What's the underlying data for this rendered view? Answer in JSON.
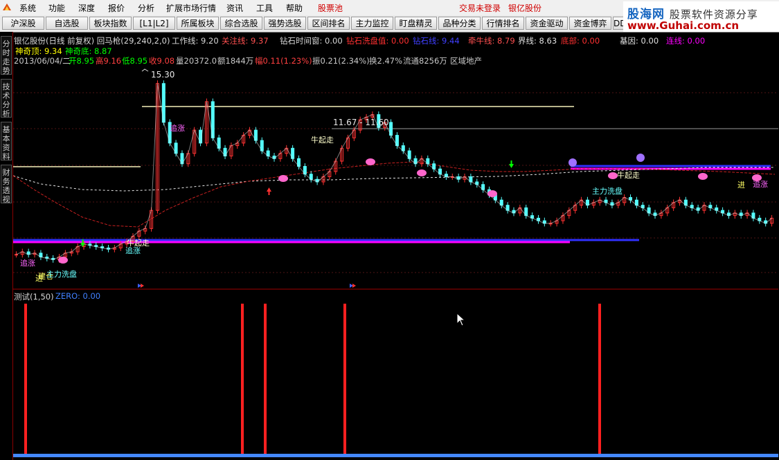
{
  "menu": {
    "items": [
      "系统",
      "功能",
      "深度",
      "报价",
      "分析",
      "扩展市场行情",
      "资讯",
      "工具",
      "帮助"
    ],
    "stock_pool": "股票池",
    "login_status": "交易未登录",
    "stock_name": "银亿股份"
  },
  "toolbar": {
    "buttons": [
      "沪深股",
      "自选股",
      "板块指数",
      "[L1|L2]",
      "所属板块",
      "综合选股",
      "强势选股",
      "区间排名",
      "主力监控",
      "盯盘精灵",
      "品种分类",
      "行情排名",
      "资金驱动",
      "资金博弈",
      "DD"
    ]
  },
  "brand": {
    "name": "股海网",
    "tagline": "股票软件资源分享",
    "url": "www.Guhai.com.cn"
  },
  "side_tabs": [
    "分时走势",
    "技术分析",
    "基本资料",
    "财务透视"
  ],
  "chart_header": {
    "line1": [
      "银亿股份(日线 前复权) 回马枪(29,240,2,0)",
      "工作线: 9.20",
      "关注线: 9.37",
      "钻石时间窗: 0.00",
      "钻石洗盘值: 0.00",
      "钻石线: 9.44",
      "牵牛线: 8.79",
      "界线: 8.63",
      "底部: 0.00",
      "基因: 0.00",
      "连线: 0.00"
    ],
    "line2": [
      "神奇顶: 9.34",
      "神奇底: 8.87"
    ],
    "line3": [
      "2013/06/04/二",
      "开8.95",
      "高9.16",
      "低8.95",
      "收9.08",
      "量20372.0",
      "额1844万",
      "幅0.11(1.23%)",
      "振0.21(2.34%)",
      "换2.47%",
      "流通8256万",
      "区域地产"
    ]
  },
  "annotations": {
    "high_price": "15.30",
    "range_label": "11.67 - 11.60",
    "labels": [
      "追涨",
      "牛起走",
      "建仓",
      "主力洗盘",
      "进",
      "追涨",
      "牛起走",
      "主力洗盘",
      "追涨",
      "牛起走",
      "进",
      "追涨"
    ]
  },
  "indicator": {
    "title": "测试(1,50)",
    "zero_label": "ZERO: 0.00"
  },
  "colors": {
    "up": "#ff3232",
    "down": "#54fcfc",
    "magenta": "#ff00ff",
    "blue": "#3030ff",
    "yellow": "#ffff00"
  },
  "chart_data": {
    "type": "line",
    "series": [
      {
        "values": [
          8.7,
          8.8,
          8.7,
          8.75,
          8.6,
          8.55,
          8.5,
          8.6,
          8.75,
          8.8,
          9.0,
          9.1,
          9.05,
          9.0,
          8.95,
          8.9,
          8.95,
          9.1,
          9.2,
          9.4,
          9.6,
          9.7,
          10.4,
          15.3,
          13.8,
          13.0,
          12.6,
          12.2,
          12.6,
          13.5,
          13.0,
          14.6,
          13.2,
          12.8,
          12.5,
          12.9,
          13.0,
          13.3,
          13.5,
          13.1,
          12.7,
          12.5,
          12.4,
          12.6,
          12.8,
          12.4,
          12.1,
          11.8,
          11.6,
          11.5,
          11.7,
          11.9,
          12.3,
          12.8,
          13.2,
          13.5,
          13.9,
          14.0,
          14.1,
          13.6,
          13.8,
          13.3,
          12.9,
          12.7,
          12.4,
          12.2,
          12.4,
          12.2,
          12.0,
          11.8,
          11.7,
          11.7,
          11.6,
          11.7,
          11.5,
          11.4,
          11.2,
          11.0,
          10.8,
          10.6,
          10.4,
          10.3,
          10.5,
          10.2,
          10.1,
          10.0,
          9.9,
          9.9,
          10.0,
          10.2,
          10.4,
          10.6,
          10.8,
          10.6,
          10.7,
          10.8,
          10.7,
          10.6,
          10.7,
          10.9,
          10.8,
          10.6,
          10.5,
          10.3,
          10.2,
          10.3,
          10.5,
          10.7,
          10.8,
          10.6,
          10.5,
          10.4,
          10.6,
          10.5,
          10.4,
          10.3,
          10.2,
          10.3,
          10.2,
          10.3,
          10.1,
          10.0,
          9.9,
          10.1
        ]
      }
    ],
    "indicator_spikes": [
      37,
      350,
      383,
      498,
      866
    ]
  }
}
